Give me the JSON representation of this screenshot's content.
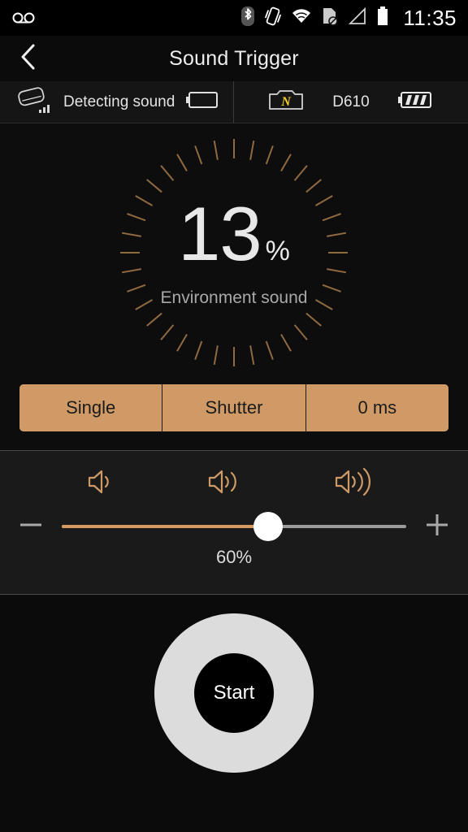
{
  "statusbar": {
    "left_icons": [
      {
        "name": "voicemail-icon"
      }
    ],
    "right_icons": [
      {
        "name": "bluetooth-icon"
      },
      {
        "name": "vibrate-icon"
      },
      {
        "name": "wifi-icon"
      },
      {
        "name": "no-sim-icon"
      },
      {
        "name": "signal-icon"
      },
      {
        "name": "battery-icon"
      }
    ],
    "time": "11:35"
  },
  "header": {
    "back_icon": "back-chevron-icon",
    "title": "Sound Trigger"
  },
  "devicebar": {
    "trigger": {
      "icon": "sound-trigger-device-icon",
      "status": "Detecting sound",
      "battery_icon": "battery-empty-icon"
    },
    "camera": {
      "icon": "nikon-camera-icon",
      "brand_letter": "N",
      "model": "D610",
      "battery_icon": "battery-three-bars-icon"
    }
  },
  "dial": {
    "value": "13",
    "unit": "%",
    "label": "Environment sound",
    "tick_count": 36,
    "tick_color": "#8f6a41"
  },
  "modes": [
    {
      "name": "shoot-mode-button",
      "label": "Single"
    },
    {
      "name": "trigger-action-button",
      "label": "Shutter"
    },
    {
      "name": "delay-button",
      "label": "0 ms"
    }
  ],
  "volume": {
    "icons": [
      {
        "name": "volume-low-icon",
        "waves": 1
      },
      {
        "name": "volume-medium-icon",
        "waves": 2
      },
      {
        "name": "volume-high-icon",
        "waves": 3
      }
    ],
    "minus_icon": "minus-icon",
    "plus_icon": "plus-icon",
    "percent": 60,
    "value_label": "60%"
  },
  "start": {
    "label": "Start"
  },
  "colors": {
    "accent": "#cf9a66",
    "slider_fill": "#d49a62",
    "tick": "#8f6a41",
    "brand_yellow": "#f2d024",
    "background": "#0d0d0d"
  },
  "chart_data": {
    "type": "gauge",
    "title": "Environment sound",
    "value": 13,
    "unit": "%",
    "range": [
      0,
      100
    ],
    "tick_count": 36
  }
}
